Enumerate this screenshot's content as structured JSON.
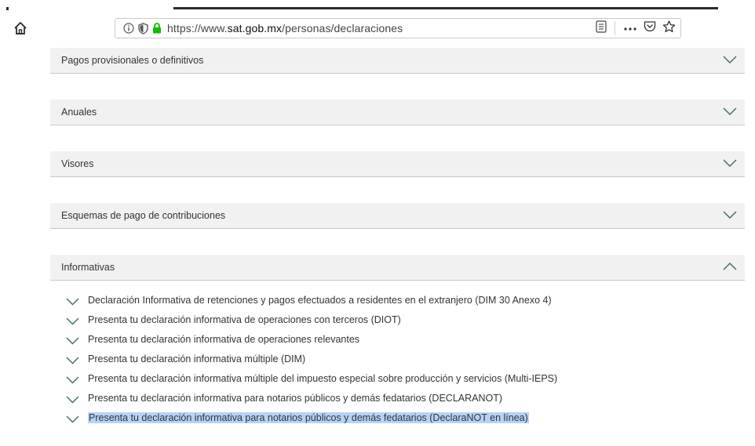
{
  "browser": {
    "url_prefix": "https://www.",
    "url_domain": "sat.gob.mx",
    "url_path": "/personas/declaraciones",
    "icons": [
      "home-icon",
      "info-icon",
      "tracking-shield-icon",
      "lock-icon",
      "reader-view-icon",
      "more-actions-icon",
      "pocket-icon",
      "bookmark-star-icon"
    ]
  },
  "accordion": {
    "sections": [
      {
        "label": "Pagos provisionales o definitivos",
        "state": "collapsed"
      },
      {
        "label": "Anuales",
        "state": "collapsed"
      },
      {
        "label": "Visores",
        "state": "collapsed"
      },
      {
        "label": "Esquemas de pago de contribuciones",
        "state": "collapsed"
      },
      {
        "label": "Informativas",
        "state": "expanded"
      }
    ],
    "informativas_items": [
      "Declaración Informativa de retenciones y pagos efectuados a residentes en el extranjero (DIM 30 Anexo 4)",
      "Presenta tu declaración informativa de operaciones con terceros (DIOT)",
      "Presenta tu declaración informativa de operaciones relevantes",
      "Presenta tu declaración informativa múltiple (DIM)",
      "Presenta tu declaración informativa múltiple del impuesto especial sobre producción y servicios (Multi-IEPS)",
      "Presenta tu declaración informativa para notarios públicos y demás fedatarios (DECLARANOT)",
      "Presenta tu declaración informativa para notarios públicos y demás fedatarios (DeclaraNOT en línea)"
    ],
    "selected_item": "Presenta tu declaración informativa para notarios públicos y demás fedatarios (DeclaraNOT en línea)"
  },
  "colors": {
    "chevron": "#3d6b63",
    "header_bg": "#f1f1f1",
    "selection": "#b5d3f7"
  }
}
